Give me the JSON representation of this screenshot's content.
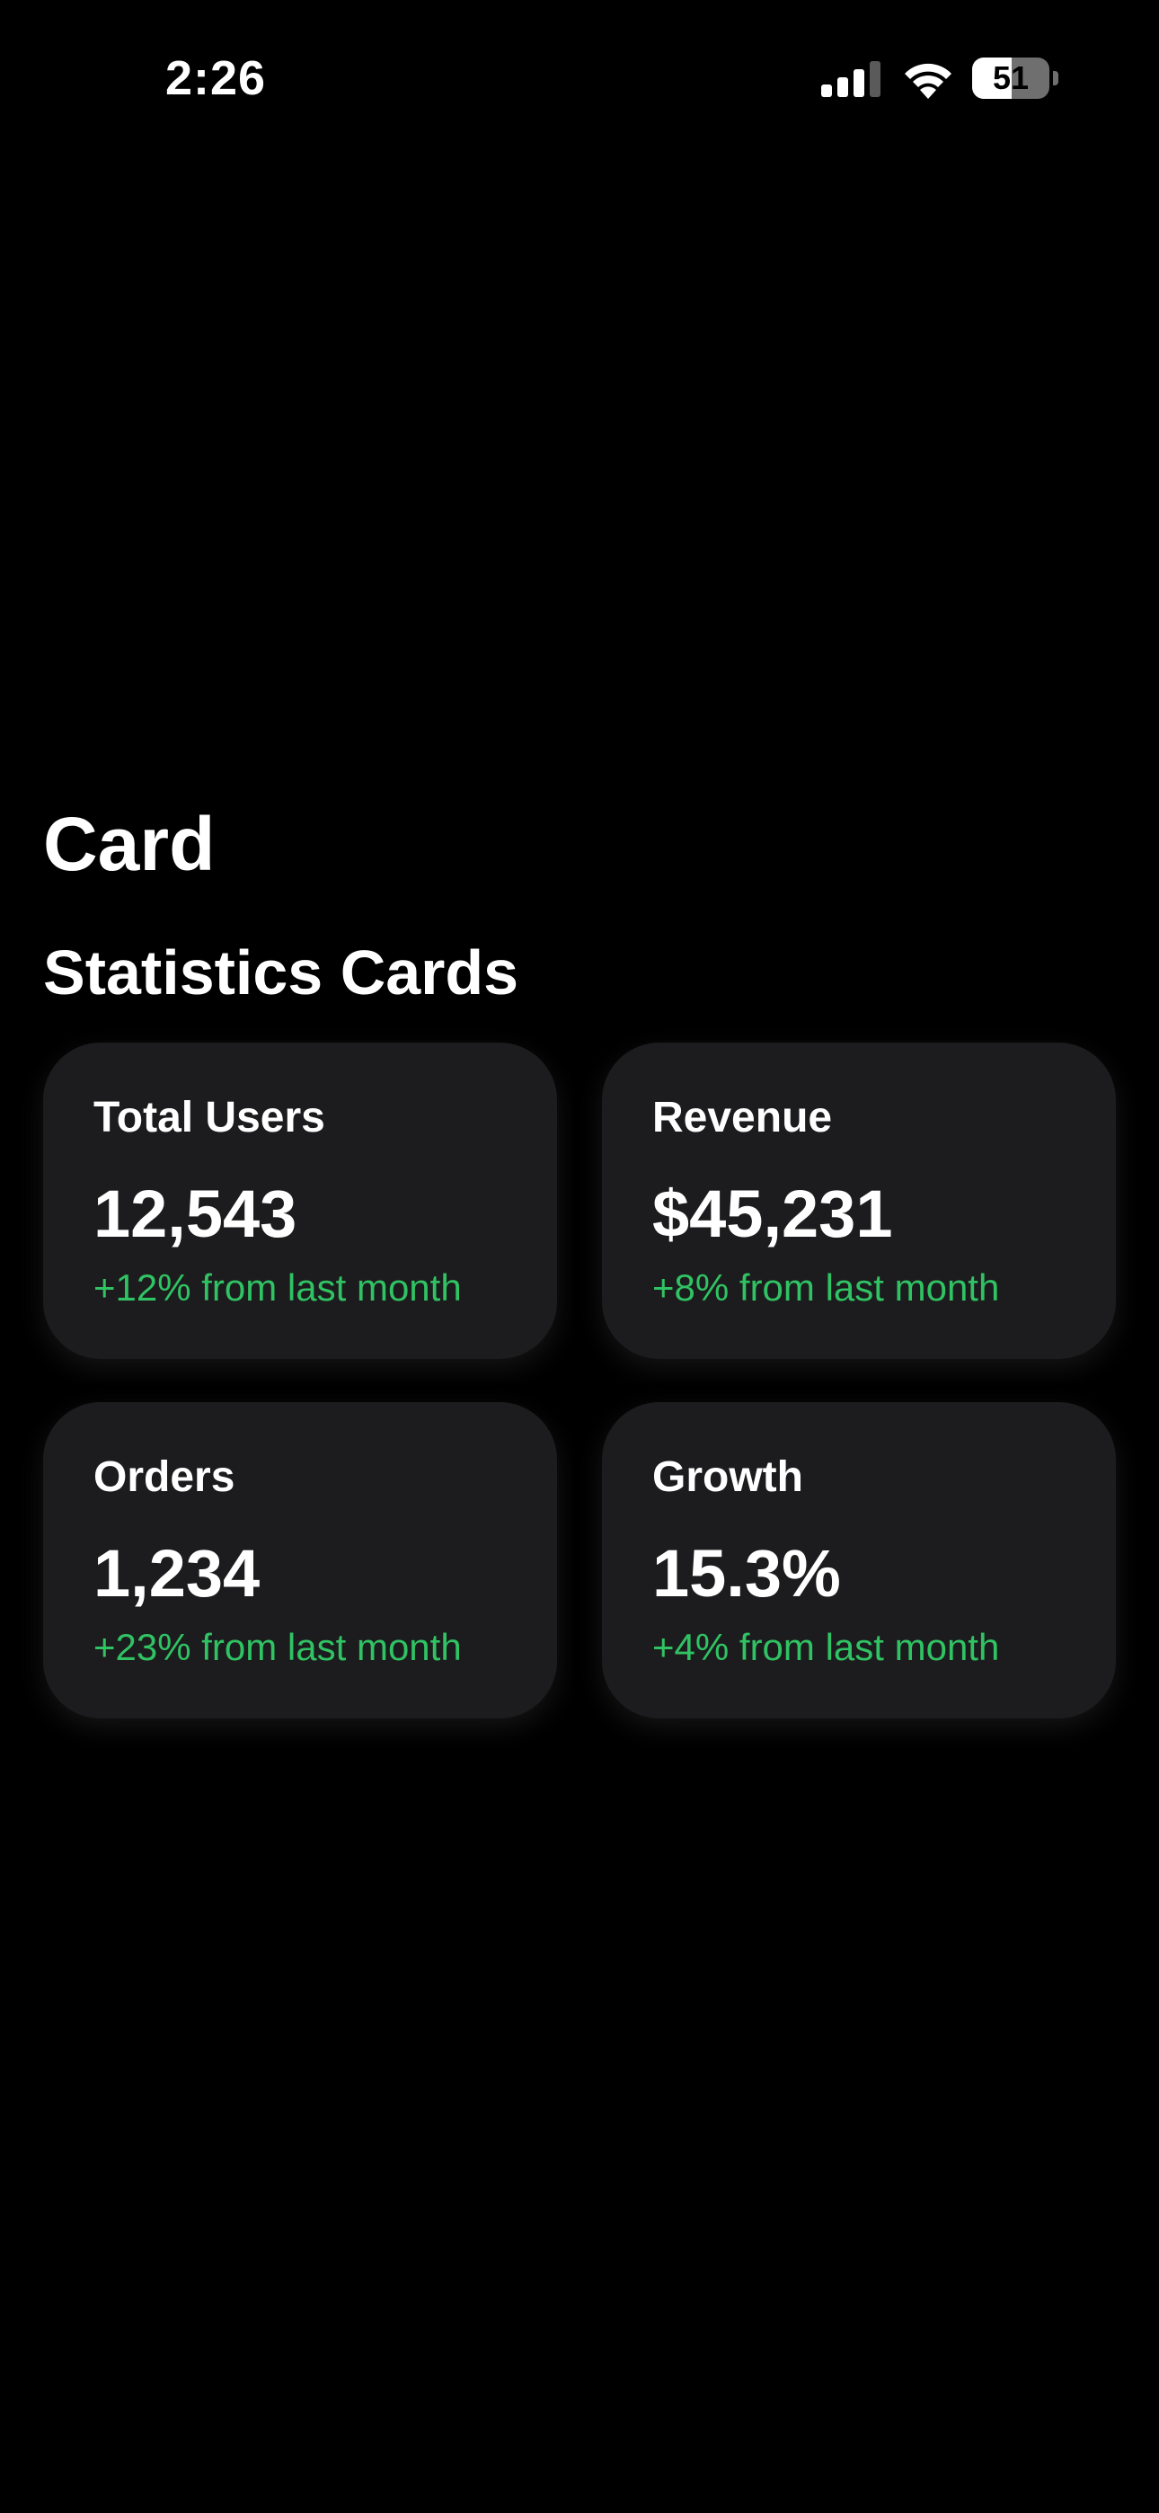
{
  "status_bar": {
    "time": "2:26",
    "battery_level": "51",
    "battery_fraction": 0.51,
    "icons": [
      "signal-icon",
      "wifi-icon",
      "battery-icon"
    ]
  },
  "page": {
    "title": "Card",
    "section_title": "Statistics Cards"
  },
  "colors": {
    "background": "#000000",
    "card_background": "#1c1c1e",
    "positive_change": "#30c263",
    "text": "#ffffff"
  },
  "cards": [
    {
      "label": "Total Users",
      "value": "12,543",
      "change": "+12% from last month"
    },
    {
      "label": "Revenue",
      "value": "$45,231",
      "change": "+8% from last month"
    },
    {
      "label": "Orders",
      "value": "1,234",
      "change": "+23% from last month"
    },
    {
      "label": "Growth",
      "value": "15.3%",
      "change": "+4% from last month"
    }
  ]
}
